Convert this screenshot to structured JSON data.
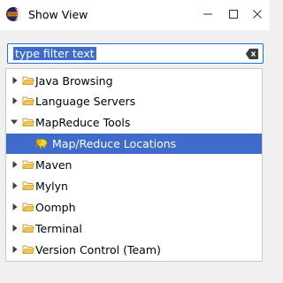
{
  "window": {
    "title": "Show View",
    "app_icon": "eclipse-icon",
    "controls": {
      "minimize_icon": "minimize-icon",
      "maximize_icon": "maximize-icon",
      "close_icon": "close-icon"
    }
  },
  "filter": {
    "value": "type filter text",
    "clear_icon": "clear-filter-icon"
  },
  "tree": {
    "items": [
      {
        "label": "Java Browsing",
        "expanded": false,
        "depth": 0,
        "icon": "folder-icon"
      },
      {
        "label": "Language Servers",
        "expanded": false,
        "depth": 0,
        "icon": "folder-icon"
      },
      {
        "label": "MapReduce Tools",
        "expanded": true,
        "depth": 0,
        "icon": "folder-icon"
      },
      {
        "label": "Map/Reduce Locations",
        "expanded": false,
        "depth": 1,
        "icon": "elephant-icon",
        "selected": true
      },
      {
        "label": "Maven",
        "expanded": false,
        "depth": 0,
        "icon": "folder-icon"
      },
      {
        "label": "Mylyn",
        "expanded": false,
        "depth": 0,
        "icon": "folder-icon"
      },
      {
        "label": "Oomph",
        "expanded": false,
        "depth": 0,
        "icon": "folder-icon"
      },
      {
        "label": "Terminal",
        "expanded": false,
        "depth": 0,
        "icon": "folder-icon"
      },
      {
        "label": "Version Control (Team)",
        "expanded": false,
        "depth": 0,
        "icon": "folder-icon"
      }
    ]
  },
  "colors": {
    "selection": "#3f6ccb",
    "focus_border": "#1f72d8",
    "folder": "#e8b23a"
  }
}
